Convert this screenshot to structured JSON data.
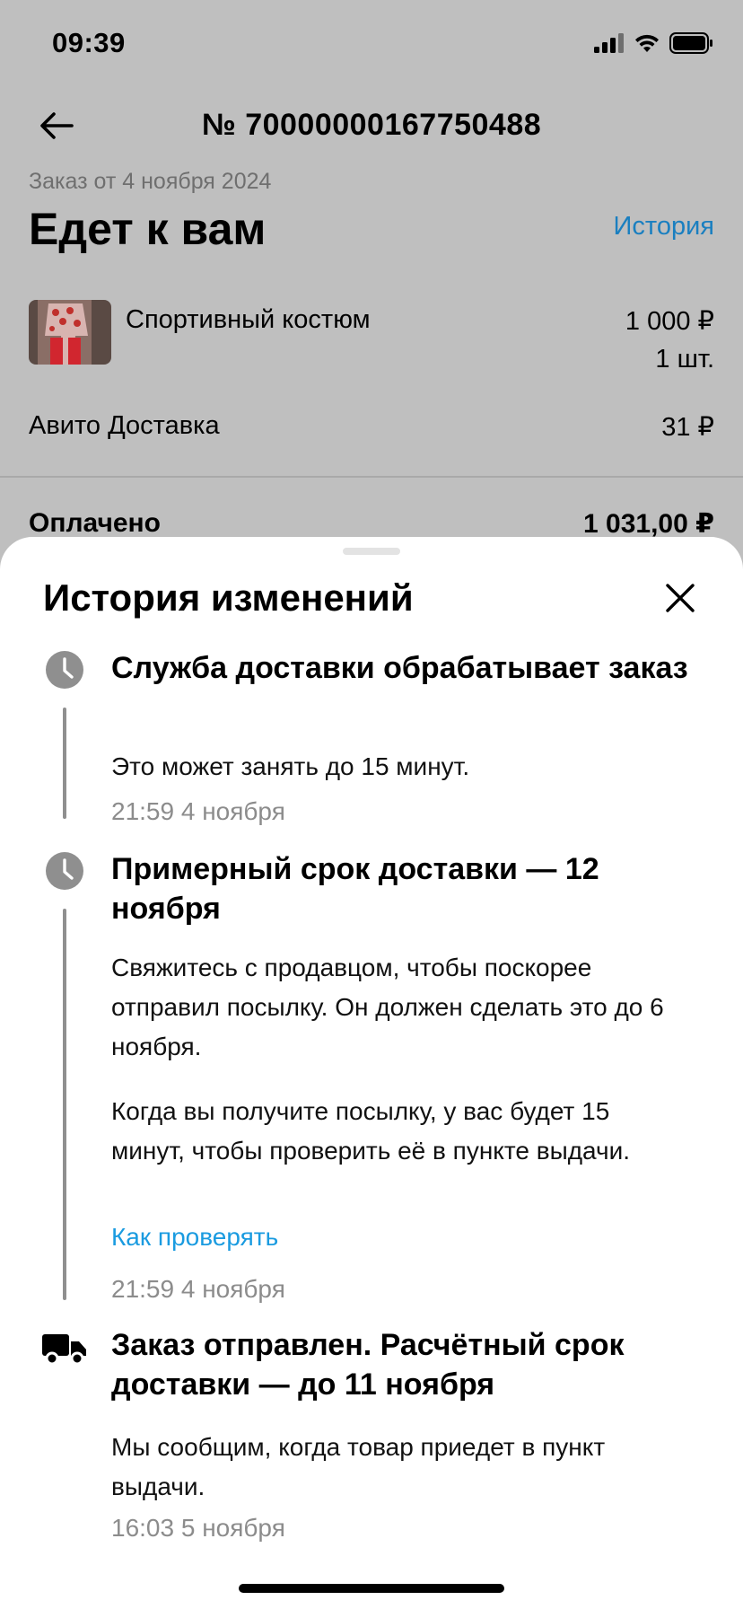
{
  "status_bar": {
    "time": "09:39"
  },
  "header": {
    "order_number": "№ 70000000167750488",
    "order_date": "Заказ от 4 ноября 2024",
    "status": "Едет к вам",
    "history_link": "История"
  },
  "item": {
    "name": "Спортивный костюм",
    "price": "1 000 ₽",
    "qty": "1 шт."
  },
  "delivery": {
    "label": "Авито Доставка",
    "price": "31 ₽"
  },
  "paid": {
    "label": "Оплачено",
    "amount": "1 031,00 ₽"
  },
  "sheet": {
    "title": "История изменений",
    "events": [
      {
        "icon": "clock-icon",
        "title": "Служба доставки обрабатывает заказ",
        "text": "Это может занять до 15 минут.",
        "time": "21:59 4 ноября"
      },
      {
        "icon": "clock-icon",
        "title": "Примерный срок доставки — 12 ноября",
        "text": "Свяжитесь с продавцом, чтобы поскорее отправил посылку. Он должен сделать это до 6 ноября.",
        "text2": "Когда вы получите посылку, у вас будет 15 минут, чтобы проверить её в пункте выдачи.",
        "link": "Как проверять",
        "time": "21:59 4 ноября"
      },
      {
        "icon": "truck-icon",
        "title": "Заказ отправлен. Расчётный срок доставки — до 11 ноября",
        "text": "Мы сообщим, когда товар приедет в пункт выдачи.",
        "time": "16:03 5 ноября"
      }
    ]
  },
  "colors": {
    "link": "#1a9be0",
    "overlay": "#bfbfbf",
    "muted": "#8c8c8c"
  }
}
